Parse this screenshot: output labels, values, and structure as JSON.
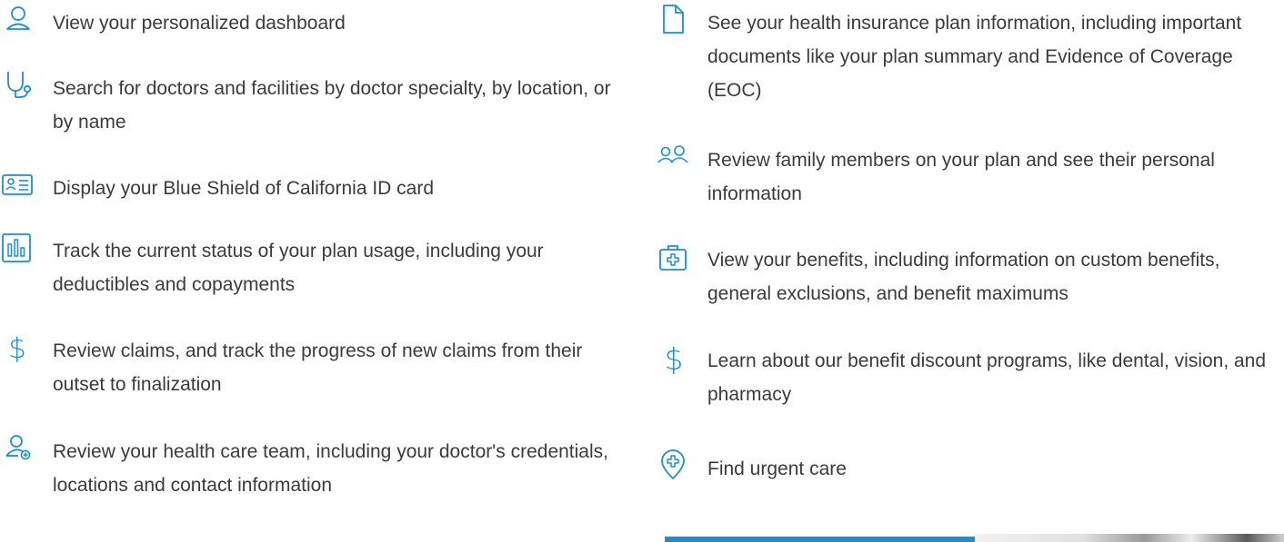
{
  "accent_color": "#1b8fd2",
  "left_features": [
    {
      "icon": "user-icon",
      "text": "View your personalized dashboard"
    },
    {
      "icon": "stethoscope-icon",
      "text": "Search for doctors and facilities by doctor specialty, by location, or by name"
    },
    {
      "icon": "id-card-icon",
      "text": "Display your Blue Shield of California ID card"
    },
    {
      "icon": "bar-chart-icon",
      "text": "Track the current status of your plan usage, including your deductibles and copayments"
    },
    {
      "icon": "dollar-icon",
      "text": "Review claims, and track the progress of new claims from their outset to finalization"
    },
    {
      "icon": "user-plus-icon",
      "text": "Review your health care team, including your doctor's credentials, locations and contact information"
    }
  ],
  "right_features": [
    {
      "icon": "document-icon",
      "text": "See your health insurance plan information, including important documents like your plan summary and Evidence of Coverage (EOC)"
    },
    {
      "icon": "family-icon",
      "text": "Review family members on your plan and see their personal information"
    },
    {
      "icon": "medical-kit-icon",
      "text": "View your benefits, including information on custom benefits, general exclusions, and benefit maximums"
    },
    {
      "icon": "dollar-icon",
      "text": "Learn about our benefit discount programs, like dental, vision, and pharmacy"
    },
    {
      "icon": "location-cross-icon",
      "text": "Find urgent care"
    }
  ]
}
